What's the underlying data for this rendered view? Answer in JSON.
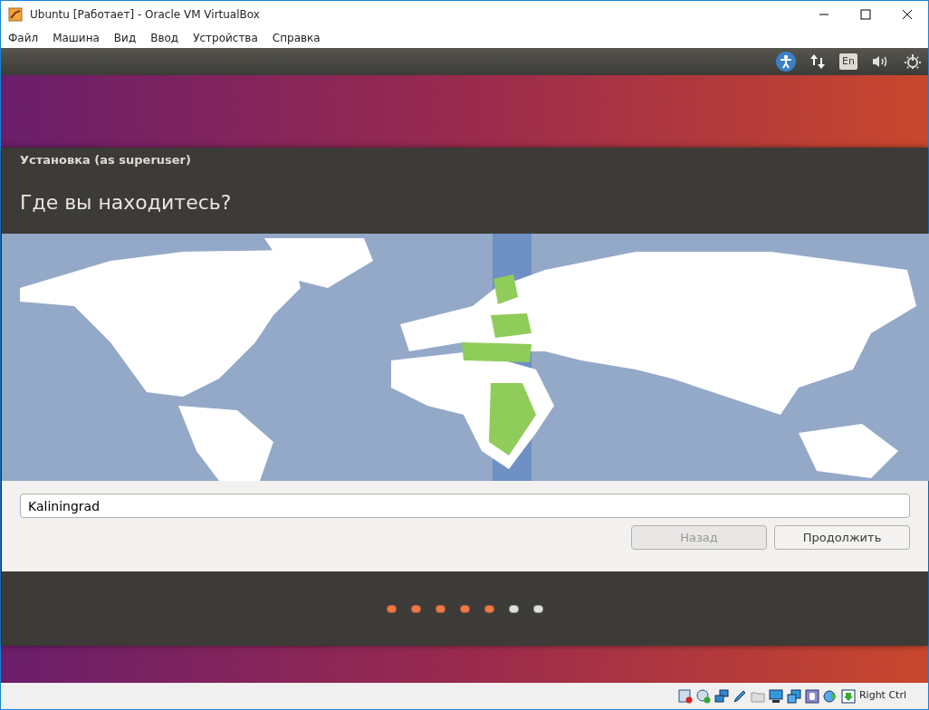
{
  "window": {
    "title": "Ubuntu [Работает] - Oracle VM VirtualBox"
  },
  "menu": [
    "Файл",
    "Машина",
    "Вид",
    "Ввод",
    "Устройства",
    "Справка"
  ],
  "panel": {
    "keyboard_layout": "En"
  },
  "dialog": {
    "title": "Установка (as superuser)",
    "heading": "Где вы находитесь?"
  },
  "location": {
    "value": "Kaliningrad"
  },
  "buttons": [
    {
      "label": "Назад",
      "disabled": true
    },
    {
      "label": "Продолжить",
      "disabled": false
    }
  ],
  "steps": [
    {
      "done": true
    },
    {
      "done": true
    },
    {
      "done": true
    },
    {
      "done": true
    },
    {
      "done": true
    },
    {
      "done": false
    },
    {
      "done": false
    }
  ],
  "status_bar": {
    "host_key": "Right Ctrl"
  }
}
